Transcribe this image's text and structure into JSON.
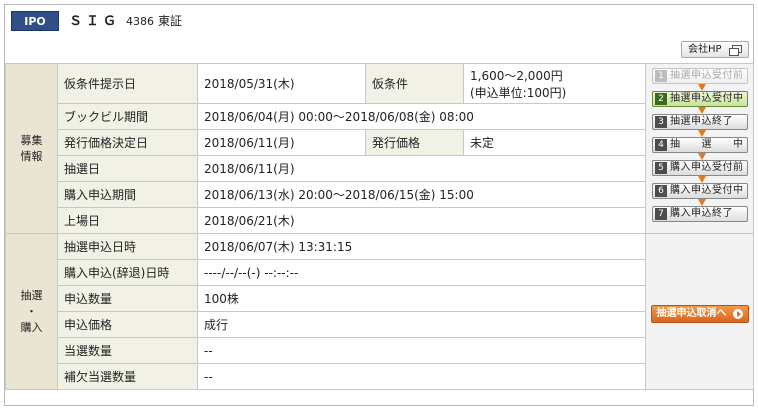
{
  "header": {
    "badge": "IPO",
    "company_name": "ＳＩＧ",
    "code": "4386",
    "market": "東証",
    "hp_button": "会社HP"
  },
  "offering": {
    "group_label": [
      "募集",
      "情報"
    ],
    "provisional_date_label": "仮条件提示日",
    "provisional_date": "2018/05/31(木)",
    "provisional_price_label": "仮条件",
    "provisional_price": "1,600～2,000円",
    "provisional_unit": "(申込単位:100円)",
    "bookbuild_label": "ブックビル期間",
    "bookbuild_value": "2018/06/04(月) 00:00～2018/06/08(金) 08:00",
    "price_decide_date_label": "発行価格決定日",
    "price_decide_date": "2018/06/11(月)",
    "issue_price_label": "発行価格",
    "issue_price": "未定",
    "lottery_date_label": "抽選日",
    "lottery_date": "2018/06/11(月)",
    "purchase_period_label": "購入申込期間",
    "purchase_period": "2018/06/13(水) 20:00～2018/06/15(金) 15:00",
    "listing_date_label": "上場日",
    "listing_date": "2018/06/21(木)"
  },
  "application": {
    "group_label": [
      "抽選",
      "・",
      "購入"
    ],
    "lottery_apply_label": "抽選申込日時",
    "lottery_apply_value": "2018/06/07(木) 13:31:15",
    "purchase_apply_label": "購入申込(辞退)日時",
    "purchase_apply_value": "----/--/--(-) --:--:--",
    "quantity_label": "申込数量",
    "quantity_value": "100株",
    "price_label": "申込価格",
    "price_value": "成行",
    "won_label": "当選数量",
    "won_value": "--",
    "backup_label": "補欠当選数量",
    "backup_value": "--"
  },
  "steps": [
    {
      "num": "1",
      "label": "抽選申込受付前",
      "state": "dim"
    },
    {
      "num": "2",
      "label": "抽選申込受付中",
      "state": "active"
    },
    {
      "num": "3",
      "label": "抽選申込終了",
      "state": "normal"
    },
    {
      "num": "4",
      "label": "抽　　選　　中",
      "state": "normal"
    },
    {
      "num": "5",
      "label": "購入申込受付前",
      "state": "normal"
    },
    {
      "num": "6",
      "label": "購入申込受付中",
      "state": "normal"
    },
    {
      "num": "7",
      "label": "購入申込終了",
      "state": "normal"
    }
  ],
  "cancel_button": "抽選申込取消へ",
  "colors": {
    "badge": "#2f4f86",
    "group_bg": "#e9e5d2",
    "label_bg": "#f2f1e5",
    "active_step": "#c7e29a",
    "cancel": "#e07a1e"
  }
}
